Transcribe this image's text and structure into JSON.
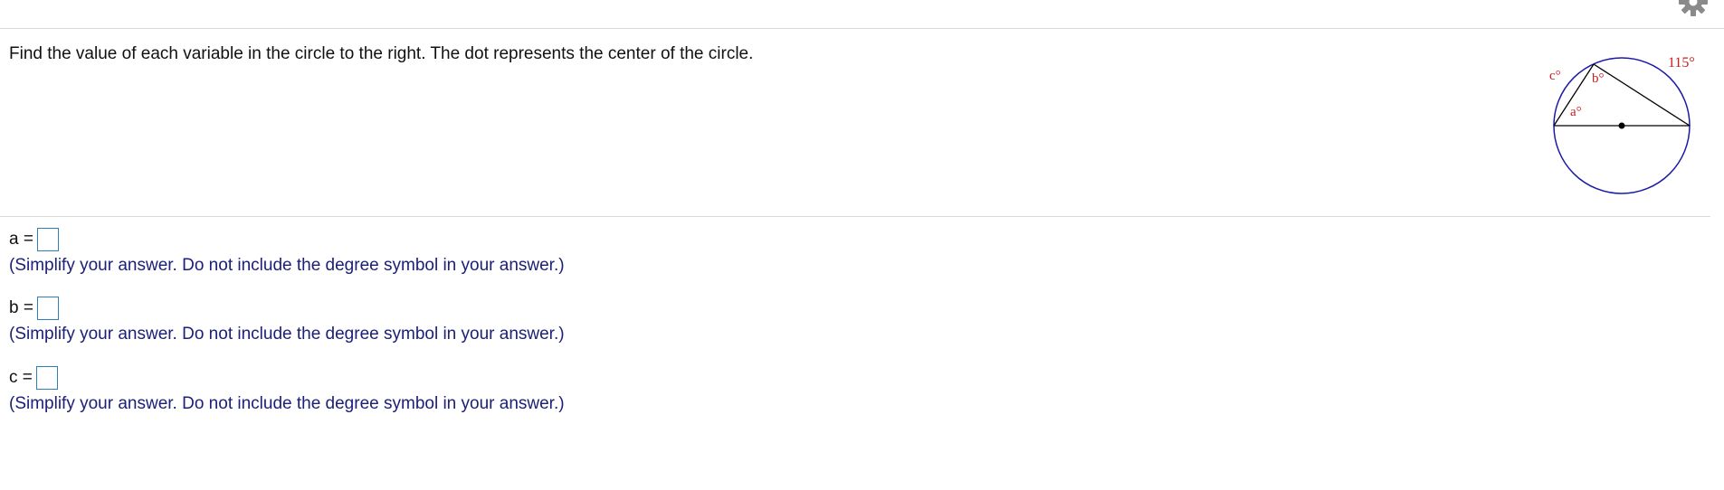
{
  "question": {
    "text": "Find the value of each variable in the circle to the right. The dot represents the center of the circle."
  },
  "figure": {
    "labels": {
      "arc": "115°",
      "c": "c°",
      "b": "b°",
      "a": "a°"
    },
    "colors": {
      "circle": "#1a1aa8",
      "labels": "#c81e1e",
      "lines": "#000000"
    }
  },
  "answers": [
    {
      "label": "a =",
      "value": "",
      "hint": "(Simplify your answer. Do not include the degree symbol in your answer.)"
    },
    {
      "label": "b =",
      "value": "",
      "hint": "(Simplify your answer. Do not include the degree symbol in your answer.)"
    },
    {
      "label": "c =",
      "value": "",
      "hint": "(Simplify your answer. Do not include the degree symbol in your answer.)"
    }
  ],
  "icons": {
    "settings": "gear-icon"
  }
}
